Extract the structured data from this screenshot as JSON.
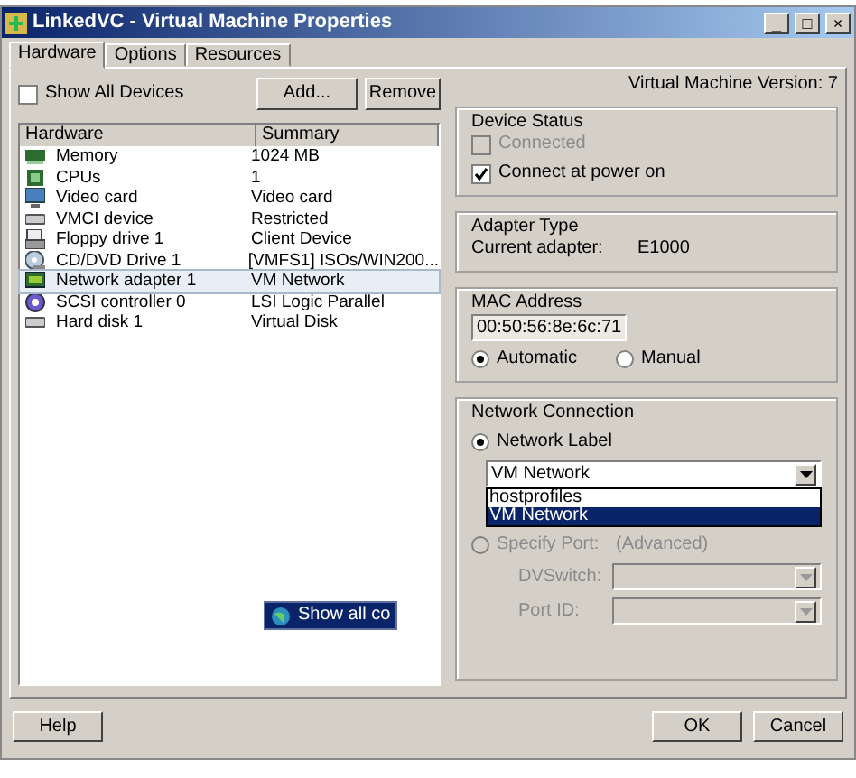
{
  "window": {
    "title": "LinkedVC - Virtual Machine Properties",
    "controls": [
      "_",
      "□",
      "×"
    ]
  },
  "tabs": [
    {
      "label": "Hardware",
      "selected": true
    },
    {
      "label": "Options",
      "selected": false
    },
    {
      "label": "Resources",
      "selected": false
    }
  ],
  "version": "Virtual Machine Version: 7",
  "show_all_devices": {
    "label": "Show All Devices",
    "checked": false
  },
  "device_buttons": [
    "Add...",
    "Remove"
  ],
  "table": {
    "columns": [
      "Hardware",
      "Summary"
    ],
    "rows": [
      {
        "kind": "memory",
        "name": "Memory",
        "summary": "1024 MB",
        "selected": false
      },
      {
        "kind": "cpu",
        "name": "CPUs",
        "summary": "1",
        "selected": false
      },
      {
        "kind": "monitor",
        "name": "Video card",
        "summary": "Video card",
        "selected": false
      },
      {
        "kind": "device",
        "name": "VMCI device",
        "summary": "Restricted",
        "selected": false
      },
      {
        "kind": "floppy",
        "name": "Floppy drive 1",
        "summary": "Client Device",
        "selected": false
      },
      {
        "kind": "disc",
        "name": "CD/DVD Drive 1",
        "summary": "[VMFS1] ISOs/WIN200...",
        "selected": false
      },
      {
        "kind": "network",
        "name": "Network adapter 1",
        "summary": "VM Network",
        "selected": true
      },
      {
        "kind": "scsi",
        "name": "SCSI controller 0",
        "summary": "LSI Logic Parallel",
        "selected": false
      },
      {
        "kind": "device",
        "name": "Hard disk 1",
        "summary": "Virtual Disk",
        "selected": false
      }
    ]
  },
  "drag_label": "Show all co",
  "device_status": {
    "title": "Device Status",
    "options": [
      {
        "label": "Connected",
        "checked": false,
        "disabled": true
      },
      {
        "label": "Connect at power on",
        "checked": true,
        "disabled": false
      }
    ]
  },
  "adapter_type": {
    "title": "Adapter Type",
    "label": "Current adapter:",
    "value": "E1000"
  },
  "mac_address": {
    "title": "MAC Address",
    "value": "00:50:56:8e:6c:71",
    "modes": [
      {
        "label": "Automatic",
        "selected": true
      },
      {
        "label": "Manual",
        "selected": false
      }
    ]
  },
  "network_connection": {
    "title": "Network Connection",
    "network_label": {
      "label": "Network Label",
      "selected": true
    },
    "combo_value": "VM Network",
    "dropdown": [
      {
        "label": "hostprofiles",
        "selected": false
      },
      {
        "label": "VM Network",
        "selected": true
      }
    ],
    "specify_port": {
      "label": "Specify Port:",
      "hint": "(Advanced)",
      "selected": false,
      "disabled": true
    },
    "fields": [
      {
        "label": "DVSwitch:",
        "disabled": true
      },
      {
        "label": "Port ID:",
        "disabled": true
      }
    ]
  },
  "footer_buttons": [
    {
      "kind": "help",
      "label": "Help"
    },
    {
      "kind": "ok",
      "label": "OK"
    },
    {
      "kind": "cancel",
      "label": "Cancel"
    }
  ]
}
